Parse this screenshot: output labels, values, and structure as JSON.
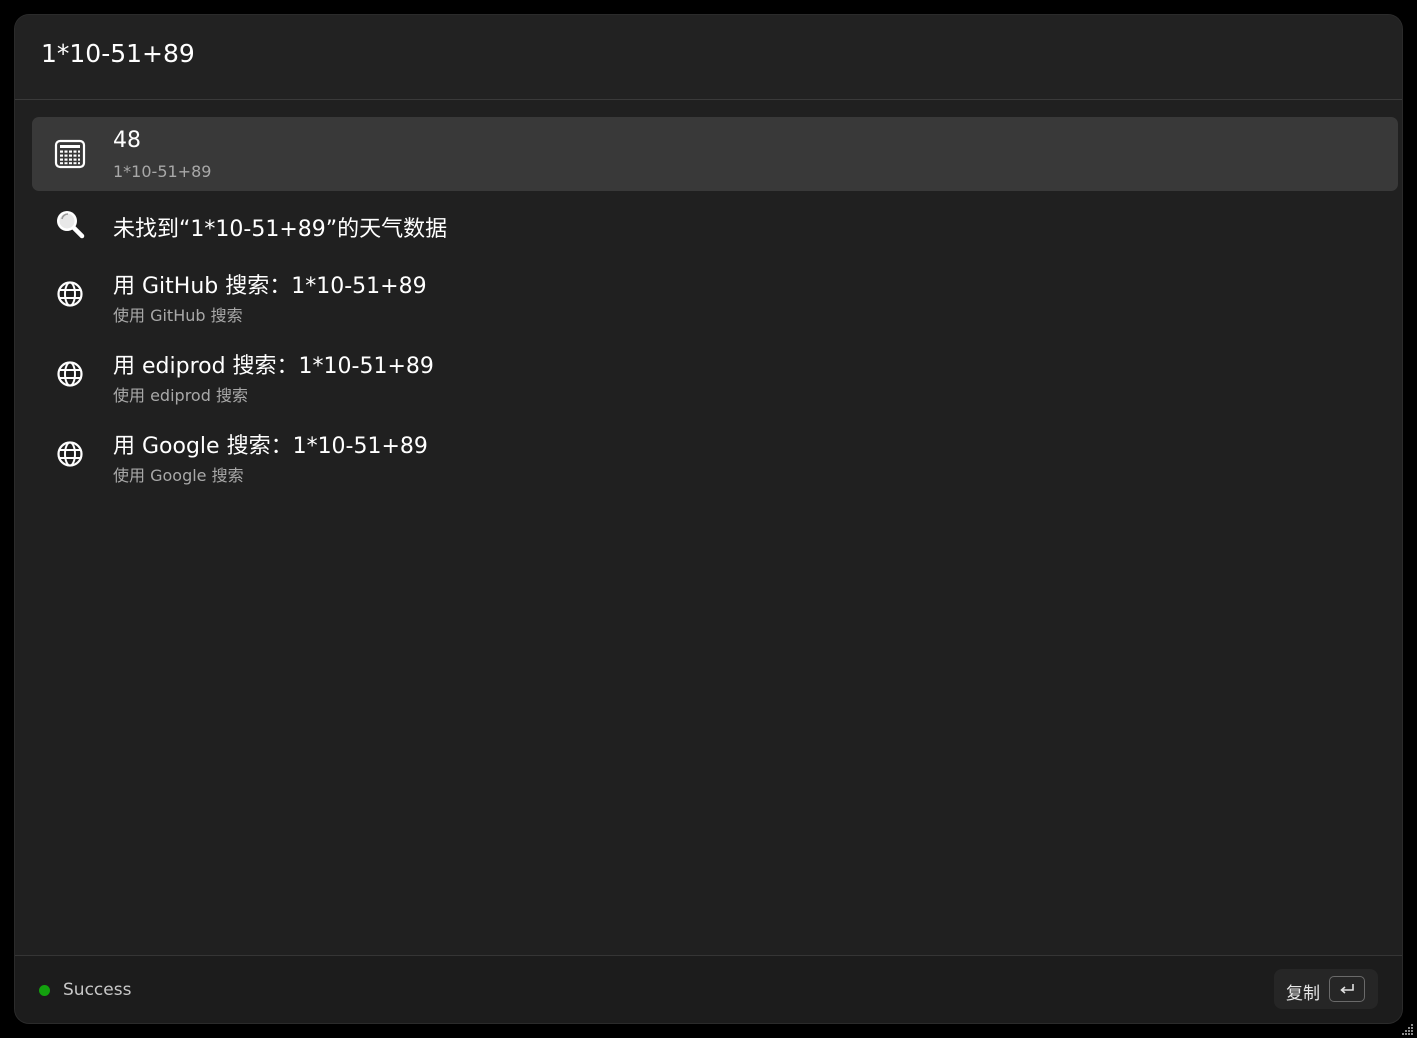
{
  "search": {
    "query": "1*10-51+89"
  },
  "results": [
    {
      "icon": "calculator-icon",
      "title": "48",
      "subtitle": "1*10-51+89"
    },
    {
      "icon": "magnifier-icon",
      "title": "未找到“1*10-51+89”的天气数据",
      "subtitle": ""
    },
    {
      "icon": "globe-icon",
      "title": "用 GitHub 搜索：1*10-51+89",
      "subtitle": "使用 GitHub 搜索"
    },
    {
      "icon": "globe-icon",
      "title": "用 ediprod 搜索：1*10-51+89",
      "subtitle": "使用 ediprod 搜索"
    },
    {
      "icon": "globe-icon",
      "title": "用 Google 搜索：1*10-51+89",
      "subtitle": "使用 Google 搜索"
    }
  ],
  "footer": {
    "status": "Success",
    "status_color": "#13a10e",
    "action_label": "复制",
    "action_key_icon": "enter-key-icon"
  }
}
